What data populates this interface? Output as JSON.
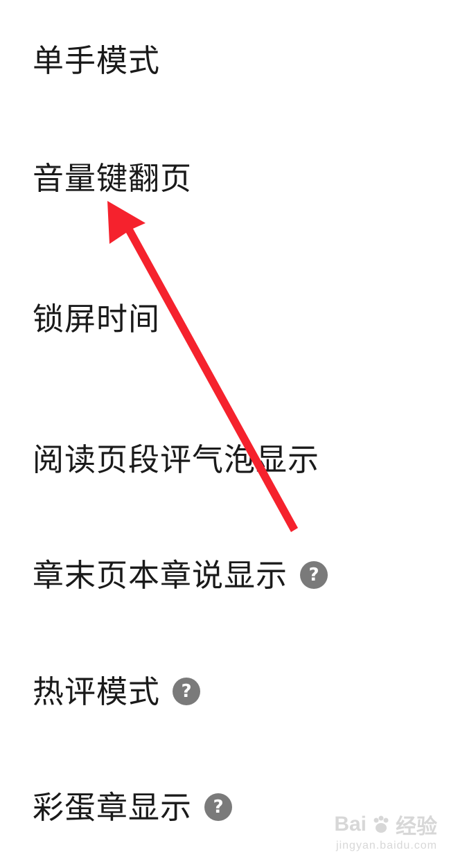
{
  "settings": {
    "items": [
      {
        "label": "单手模式",
        "has_help": false
      },
      {
        "label": "音量键翻页",
        "has_help": false
      },
      {
        "label": "锁屏时间",
        "has_help": false
      },
      {
        "label": "阅读页段评气泡显示",
        "has_help": false
      },
      {
        "label": "章末页本章说显示",
        "has_help": true
      },
      {
        "label": "热评模式",
        "has_help": true
      },
      {
        "label": "彩蛋章显示",
        "has_help": true
      }
    ],
    "help_glyph": "?"
  },
  "annotation": {
    "color": "#f5222d",
    "icon": "red-arrow-icon",
    "points_to": "音量键翻页"
  },
  "watermark": {
    "brand": "Bai",
    "brand_suffix": "经验",
    "domain": "jingyan.baidu.com"
  }
}
